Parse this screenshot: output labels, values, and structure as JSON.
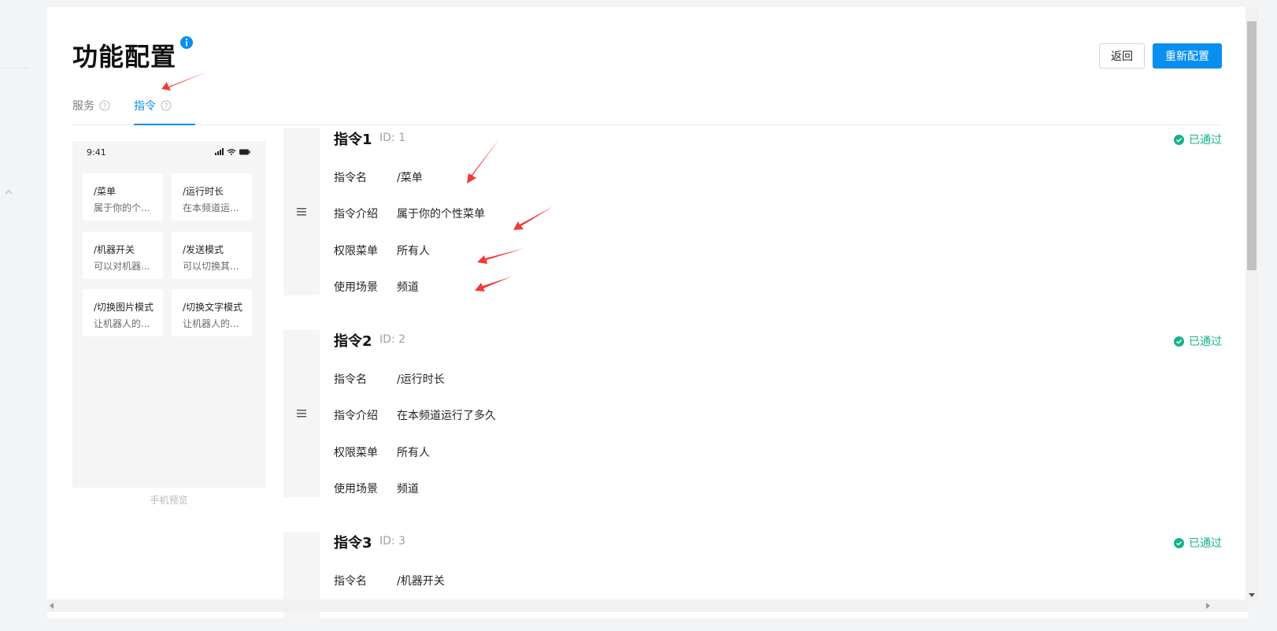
{
  "page": {
    "title": "功能配置",
    "back_label": "返回",
    "reconfigure_label": "重新配置"
  },
  "tabs": [
    {
      "label": "服务",
      "active": false
    },
    {
      "label": "指令",
      "active": true
    }
  ],
  "phone_preview": {
    "time": "9:41",
    "caption": "手机预览",
    "commands": [
      {
        "name": "/菜单",
        "desc": "属于你的个..."
      },
      {
        "name": "/运行时长",
        "desc": "在本频道运..."
      },
      {
        "name": "/机器开关",
        "desc": "可以对机器..."
      },
      {
        "name": "/发送模式",
        "desc": "可以切换其..."
      },
      {
        "name": "/切换图片模式",
        "desc": "让机器人的..."
      },
      {
        "name": "/切换文字模式",
        "desc": "让机器人的..."
      }
    ]
  },
  "field_labels": {
    "name": "指令名",
    "intro": "指令介绍",
    "permission": "权限菜单",
    "scene": "使用场景"
  },
  "commands": [
    {
      "title": "指令1",
      "id": "ID: 1",
      "status": "已通过",
      "name": "/菜单",
      "intro": "属于你的个性菜单",
      "permission": "所有人",
      "scene": "频道"
    },
    {
      "title": "指令2",
      "id": "ID: 2",
      "status": "已通过",
      "name": "/运行时长",
      "intro": "在本频道运行了多久",
      "permission": "所有人",
      "scene": "频道"
    },
    {
      "title": "指令3",
      "id": "ID: 3",
      "status": "已通过",
      "name": "/机器开关"
    }
  ],
  "colors": {
    "accent": "#0a8ff0",
    "approved": "#14b28a",
    "annotation_arrow": "#f03a3a"
  }
}
